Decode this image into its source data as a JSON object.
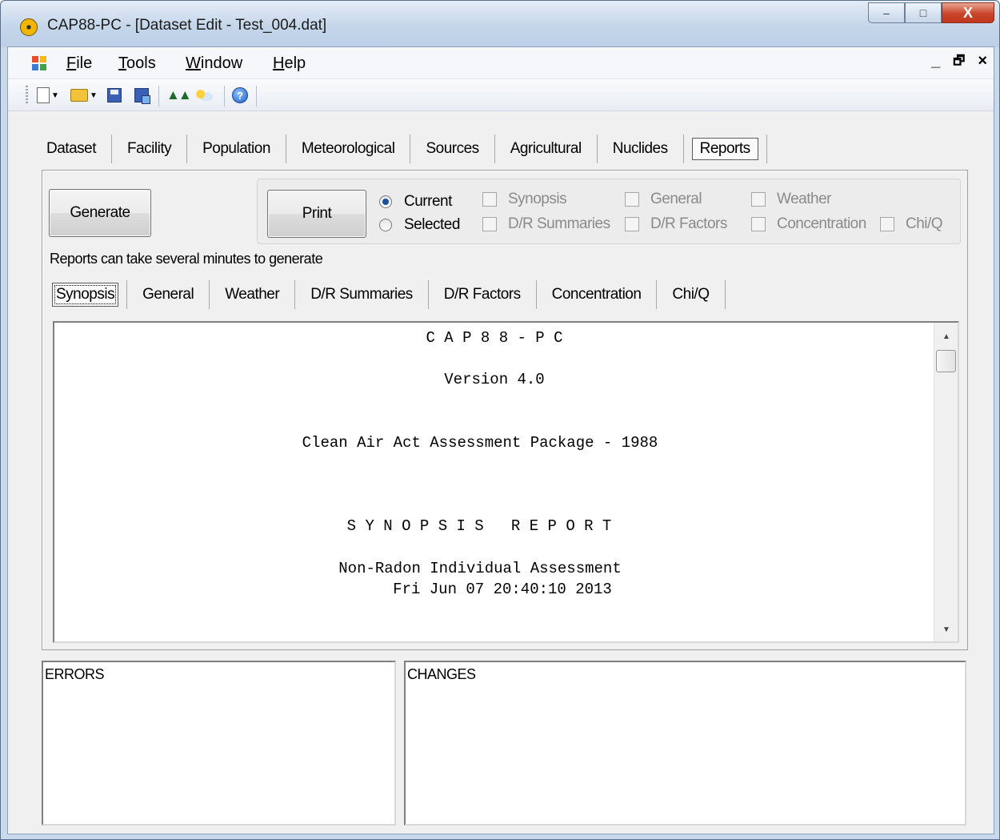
{
  "window": {
    "title": "CAP88-PC - [Dataset Edit - Test_004.dat]",
    "caption_minimize": "–",
    "caption_maximize": "□",
    "caption_close": "X"
  },
  "menubar": {
    "items": [
      {
        "key": "F",
        "rest": "ile"
      },
      {
        "key": "T",
        "rest": "ools"
      },
      {
        "key": "W",
        "rest": "indow"
      },
      {
        "key": "H",
        "rest": "elp"
      }
    ],
    "mdi_minimize": "_",
    "mdi_restore": "🗗",
    "mdi_close": "×"
  },
  "toolbar": {
    "icons": [
      "new-file-icon",
      "open-folder-icon",
      "save-icon",
      "save-as-icon",
      "find-icon",
      "weather-icon",
      "help-icon"
    ]
  },
  "main_tabs": [
    "Dataset",
    "Facility",
    "Population",
    "Meteorological",
    "Sources",
    "Agricultural",
    "Nuclides",
    "Reports"
  ],
  "active_main_tab": "Reports",
  "reports": {
    "generate_label": "Generate",
    "print_label": "Print",
    "radio_current": "Current",
    "radio_selected": "Selected",
    "selected_radio": "Current",
    "checkboxes": {
      "synopsis": "Synopsis",
      "general": "General",
      "weather": "Weather",
      "dr_summaries": "D/R Summaries",
      "dr_factors": "D/R Factors",
      "concentration": "Concentration",
      "chiq": "Chi/Q"
    },
    "note": "Reports can take several minutes to generate",
    "report_tabs": [
      "Synopsis",
      "General",
      "Weather",
      "D/R Summaries",
      "D/R Factors",
      "Concentration",
      "Chi/Q"
    ],
    "active_report_tab": "Synopsis",
    "content": {
      "line1": "C A P 8 8 - P C",
      "line2": "Version 4.0",
      "line3": "Clean Air Act Assessment Package - 1988",
      "line4": "S Y N O P S I S   R E P O R T",
      "line5": "Non-Radon Individual Assessment",
      "line6": "Fri Jun 07 20:40:10 2013"
    },
    "scroll_up": "▲",
    "scroll_down": "▼"
  },
  "errors_title": "ERRORS",
  "changes_title": "CHANGES"
}
